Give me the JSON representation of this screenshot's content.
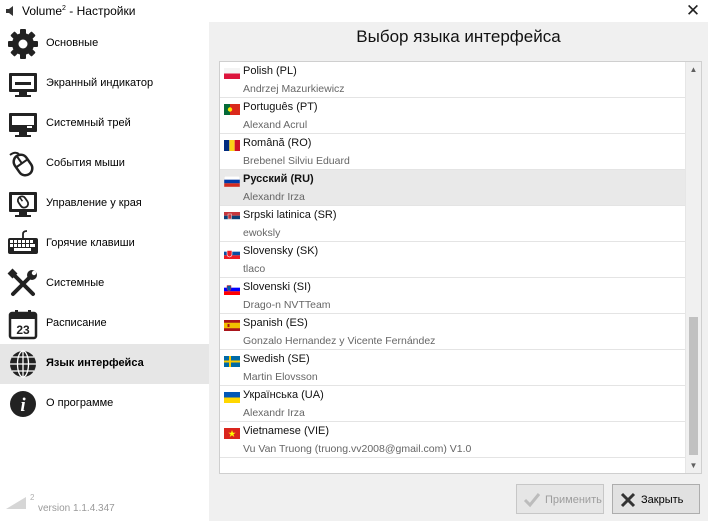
{
  "window": {
    "title_main": "Volume",
    "title_sup": "2",
    "title_rest": " - Настройки"
  },
  "sidebar": {
    "items": [
      {
        "label": "Основные",
        "icon": "gear-icon"
      },
      {
        "label": "Экранный индикатор",
        "icon": "monitor-icon"
      },
      {
        "label": "Системный трей",
        "icon": "tray-icon"
      },
      {
        "label": "События мыши",
        "icon": "mouse-icon"
      },
      {
        "label": "Управление у края",
        "icon": "screen-edge-icon"
      },
      {
        "label": "Горячие клавиши",
        "icon": "keyboard-icon"
      },
      {
        "label": "Системные",
        "icon": "tools-icon"
      },
      {
        "label": "Расписание",
        "icon": "calendar-icon",
        "icon_text": "23"
      },
      {
        "label": "Язык интерфейса",
        "icon": "globe-icon"
      },
      {
        "label": "О программе",
        "icon": "info-icon",
        "icon_text": "i"
      }
    ],
    "active_index": 8,
    "version_logo_text": "2",
    "version": "version 1.1.4.347"
  },
  "main": {
    "title": "Выбор языка интерфейса",
    "languages": [
      {
        "name": "Polish (PL)",
        "author": "Andrzej Mazurkiewicz"
      },
      {
        "name": "Português (PT)",
        "author": "Alexand Acrul"
      },
      {
        "name": "Română (RO)",
        "author": "Brebenel Silviu Eduard"
      },
      {
        "name": "Русский (RU)",
        "author": "Alexandr Irza",
        "selected": true
      },
      {
        "name": "Srpski latinica (SR)",
        "author": "ewoksly"
      },
      {
        "name": "Slovensky (SK)",
        "author": "tlaco"
      },
      {
        "name": "Slovenski (SI)",
        "author": "Drago-n NVTTeam"
      },
      {
        "name": "Spanish (ES)",
        "author": "Gonzalo Hernandez y Vicente Fernández"
      },
      {
        "name": "Swedish (SE)",
        "author": "Martin Elovsson"
      },
      {
        "name": "Українська (UA)",
        "author": "Alexandr Irza"
      },
      {
        "name": "Vietnamese (VIE)",
        "author": "Vu Van Truong (truong.vv2008@gmail.com) V1.0"
      }
    ],
    "scroll": {
      "up": "▲",
      "down": "▼"
    }
  },
  "buttons": {
    "apply_label": "Применить",
    "close_label": "Закрыть"
  },
  "window_close": "✕"
}
